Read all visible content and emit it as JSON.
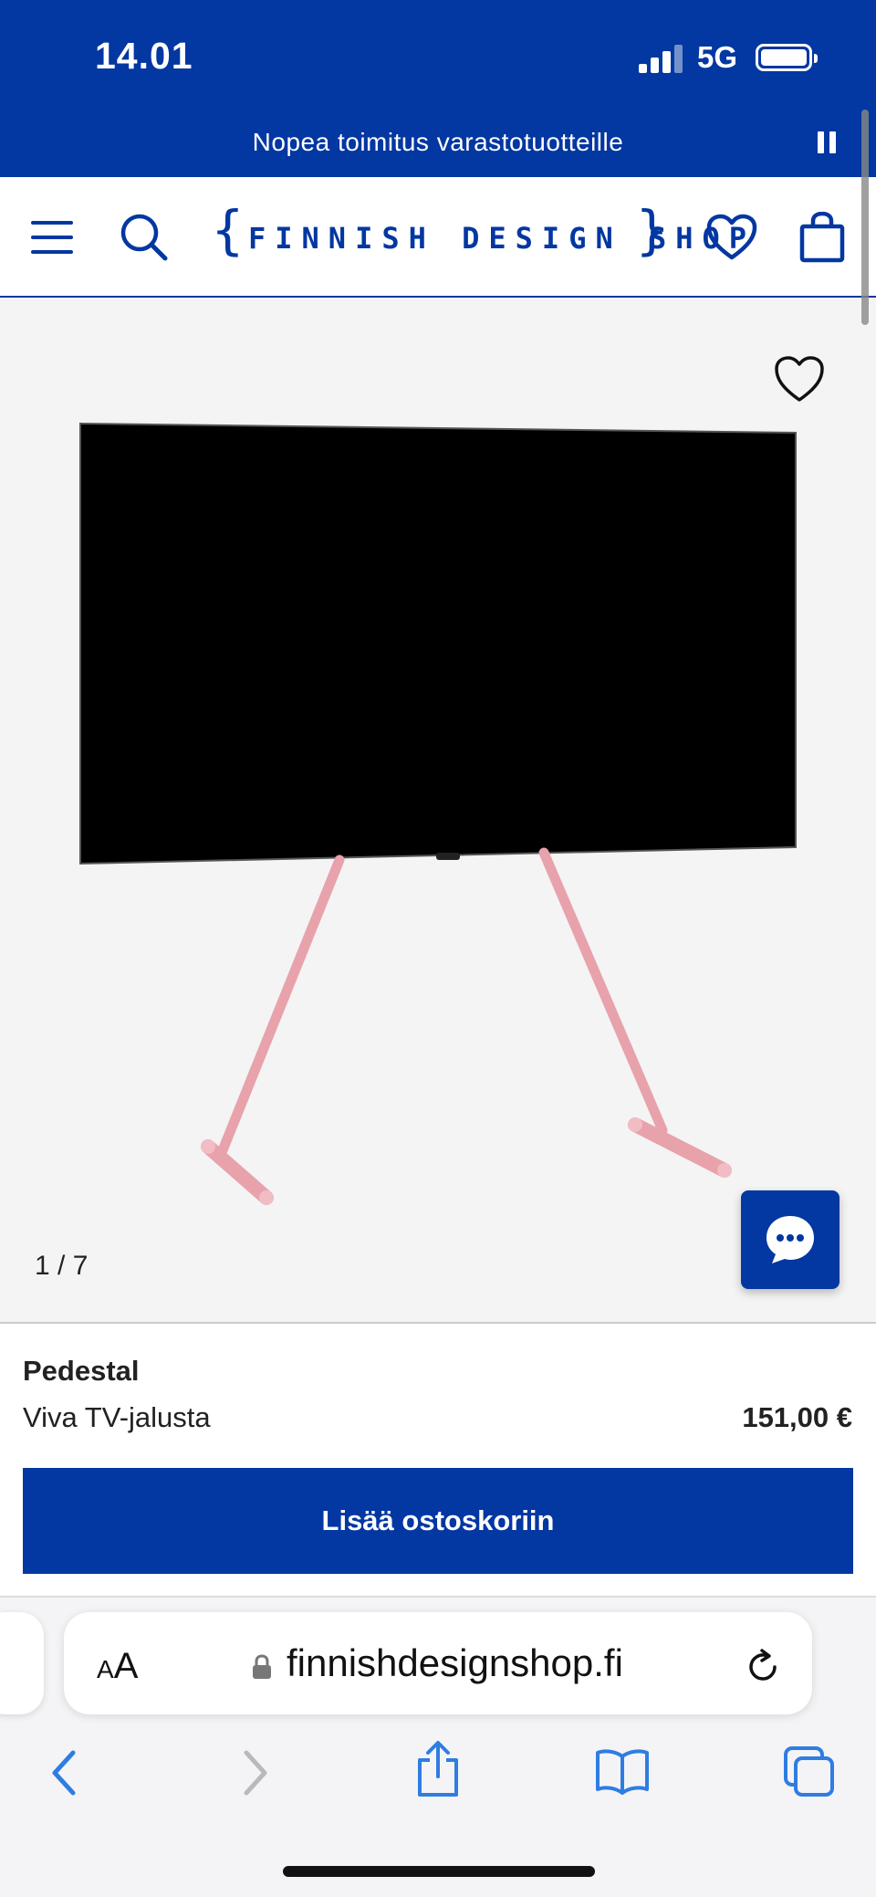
{
  "status_bar": {
    "time": "14.01",
    "network": "5G"
  },
  "promo": {
    "text": "Nopea toimitus varastotuotteille"
  },
  "header": {
    "logo_brace_left": "{",
    "logo_text": "FINNISH DESIGN SHOP",
    "logo_brace_right": "}"
  },
  "gallery": {
    "counter": "1 / 7"
  },
  "product": {
    "brand": "Pedestal",
    "name": "Viva TV-jalusta",
    "price": "151,00 €",
    "add_to_cart_label": "Lisää ostoskoriin"
  },
  "browser": {
    "text_size_small": "A",
    "text_size_big": "A",
    "url": "finnishdesignshop.fi"
  },
  "colors": {
    "brand_blue": "#0337a1",
    "stand_pink": "#e8a2ac",
    "ios_blue": "#2f7de1"
  },
  "icons": [
    "hamburger-menu-icon",
    "search-icon",
    "heart-icon",
    "shopping-bag-icon",
    "pause-icon",
    "chat-icon",
    "lock-icon",
    "reload-icon",
    "back-icon",
    "forward-icon",
    "share-icon",
    "bookmarks-icon",
    "tabs-icon"
  ]
}
